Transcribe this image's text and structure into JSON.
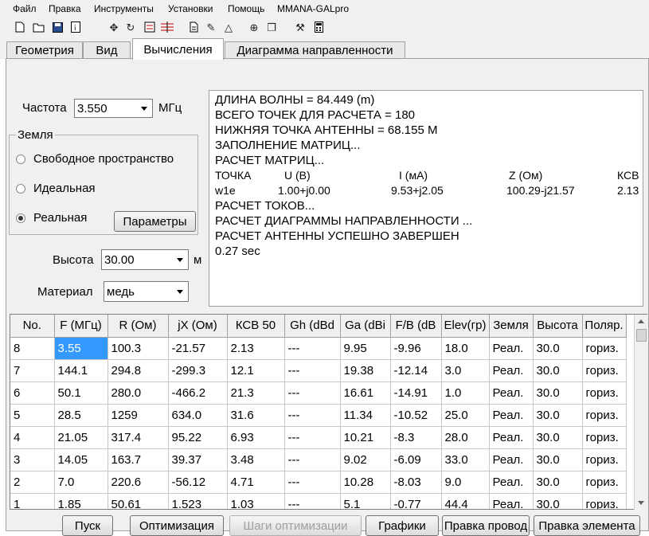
{
  "menu": [
    "Файл",
    "Правка",
    "Инструменты",
    "Установки",
    "Помощь",
    "MMANA-GALpro"
  ],
  "toolbar_icons": [
    "new-file-icon",
    "open-folder-icon",
    "save-icon",
    "info-icon",
    "move-icon",
    "rotate-icon",
    "properties-icon",
    "wires-icon",
    "page-icon",
    "edit-icon",
    "triangle-icon",
    "target-icon",
    "copy-icon",
    "tools-icon",
    "calculator-icon"
  ],
  "tabs": [
    "Геометрия",
    "Вид",
    "Вычисления",
    "Диаграмма направленности"
  ],
  "active_tab": "Вычисления",
  "frequency": {
    "label": "Частота",
    "value": "3.550",
    "unit": "МГц"
  },
  "ground": {
    "legend": "Земля",
    "options": [
      "Свободное пространство",
      "Идеальная",
      "Реальная"
    ],
    "selected": "Реальная",
    "params_button": "Параметры"
  },
  "height": {
    "label": "Высота",
    "value": "30.00",
    "unit": "м"
  },
  "material": {
    "label": "Материал",
    "value": "медь"
  },
  "console": {
    "lines": [
      "ДЛИНА ВОЛНЫ = 84.449 (m)",
      "ВСЕГО ТОЧЕК ДЛЯ РАСЧЕТА = 180",
      "НИЖНЯЯ ТОЧКА АНТЕННЫ = 68.155 M",
      "ЗАПОЛНЕНИЕ МАТРИЦ...",
      "РАСЧЕТ МАТРИЦ..."
    ],
    "table_header": [
      "ТОЧКА",
      "U (B)",
      "I (мА)",
      "Z (Ом)",
      "КСВ"
    ],
    "table_row": [
      "w1e",
      "1.00+j0.00",
      "9.53+j2.05",
      "100.29-j21.57",
      "2.13"
    ],
    "lines_after": [
      "РАСЧЕТ ТОКОВ...",
      "РАСЧЕТ ДИАГРАММЫ НАПРАВЛЕННОСТИ ...",
      "РАСЧЕТ АНТЕННЫ УСПЕШНО ЗАВЕРШЕН",
      "0.27 sec"
    ]
  },
  "grid": {
    "columns": [
      "No.",
      "F (МГц)",
      "R (Ом)",
      "jX (Ом)",
      "КСВ 50",
      "Gh (dBd",
      "Ga (dBi",
      "F/B (dB",
      "Elev(гр)",
      "Земля",
      "Высота",
      "Поляр."
    ],
    "rows": [
      [
        "8",
        "3.55",
        "100.3",
        "-21.57",
        "2.13",
        "---",
        "9.95",
        "-9.96",
        "18.0",
        "Реал.",
        "30.0",
        "гориз."
      ],
      [
        "7",
        "144.1",
        "294.8",
        "-299.3",
        "12.1",
        "---",
        "19.38",
        "-12.14",
        "3.0",
        "Реал.",
        "30.0",
        "гориз."
      ],
      [
        "6",
        "50.1",
        "280.0",
        "-466.2",
        "21.3",
        "---",
        "16.61",
        "-14.91",
        "1.0",
        "Реал.",
        "30.0",
        "гориз."
      ],
      [
        "5",
        "28.5",
        "1259",
        "634.0",
        "31.6",
        "---",
        "11.34",
        "-10.52",
        "25.0",
        "Реал.",
        "30.0",
        "гориз."
      ],
      [
        "4",
        "21.05",
        "317.4",
        "95.22",
        "6.93",
        "---",
        "10.21",
        "-8.3",
        "28.0",
        "Реал.",
        "30.0",
        "гориз."
      ],
      [
        "3",
        "14.05",
        "163.7",
        "39.37",
        "3.48",
        "---",
        "9.02",
        "-6.09",
        "33.0",
        "Реал.",
        "30.0",
        "гориз."
      ],
      [
        "2",
        "7.0",
        "220.6",
        "-56.12",
        "4.71",
        "---",
        "10.28",
        "-8.03",
        "9.0",
        "Реал.",
        "30.0",
        "гориз."
      ],
      [
        "1",
        "1.85",
        "50.61",
        "1.523",
        "1.03",
        "---",
        "5.1",
        "-0.77",
        "44.4",
        "Реал.",
        "30.0",
        "гориз."
      ]
    ]
  },
  "buttons": {
    "start": "Пуск",
    "optimize": "Оптимизация",
    "opt_steps": "Шаги оптимизации",
    "graphs": "Графики",
    "edit_wire": "Правка провод",
    "edit_element": "Правка элемента"
  }
}
